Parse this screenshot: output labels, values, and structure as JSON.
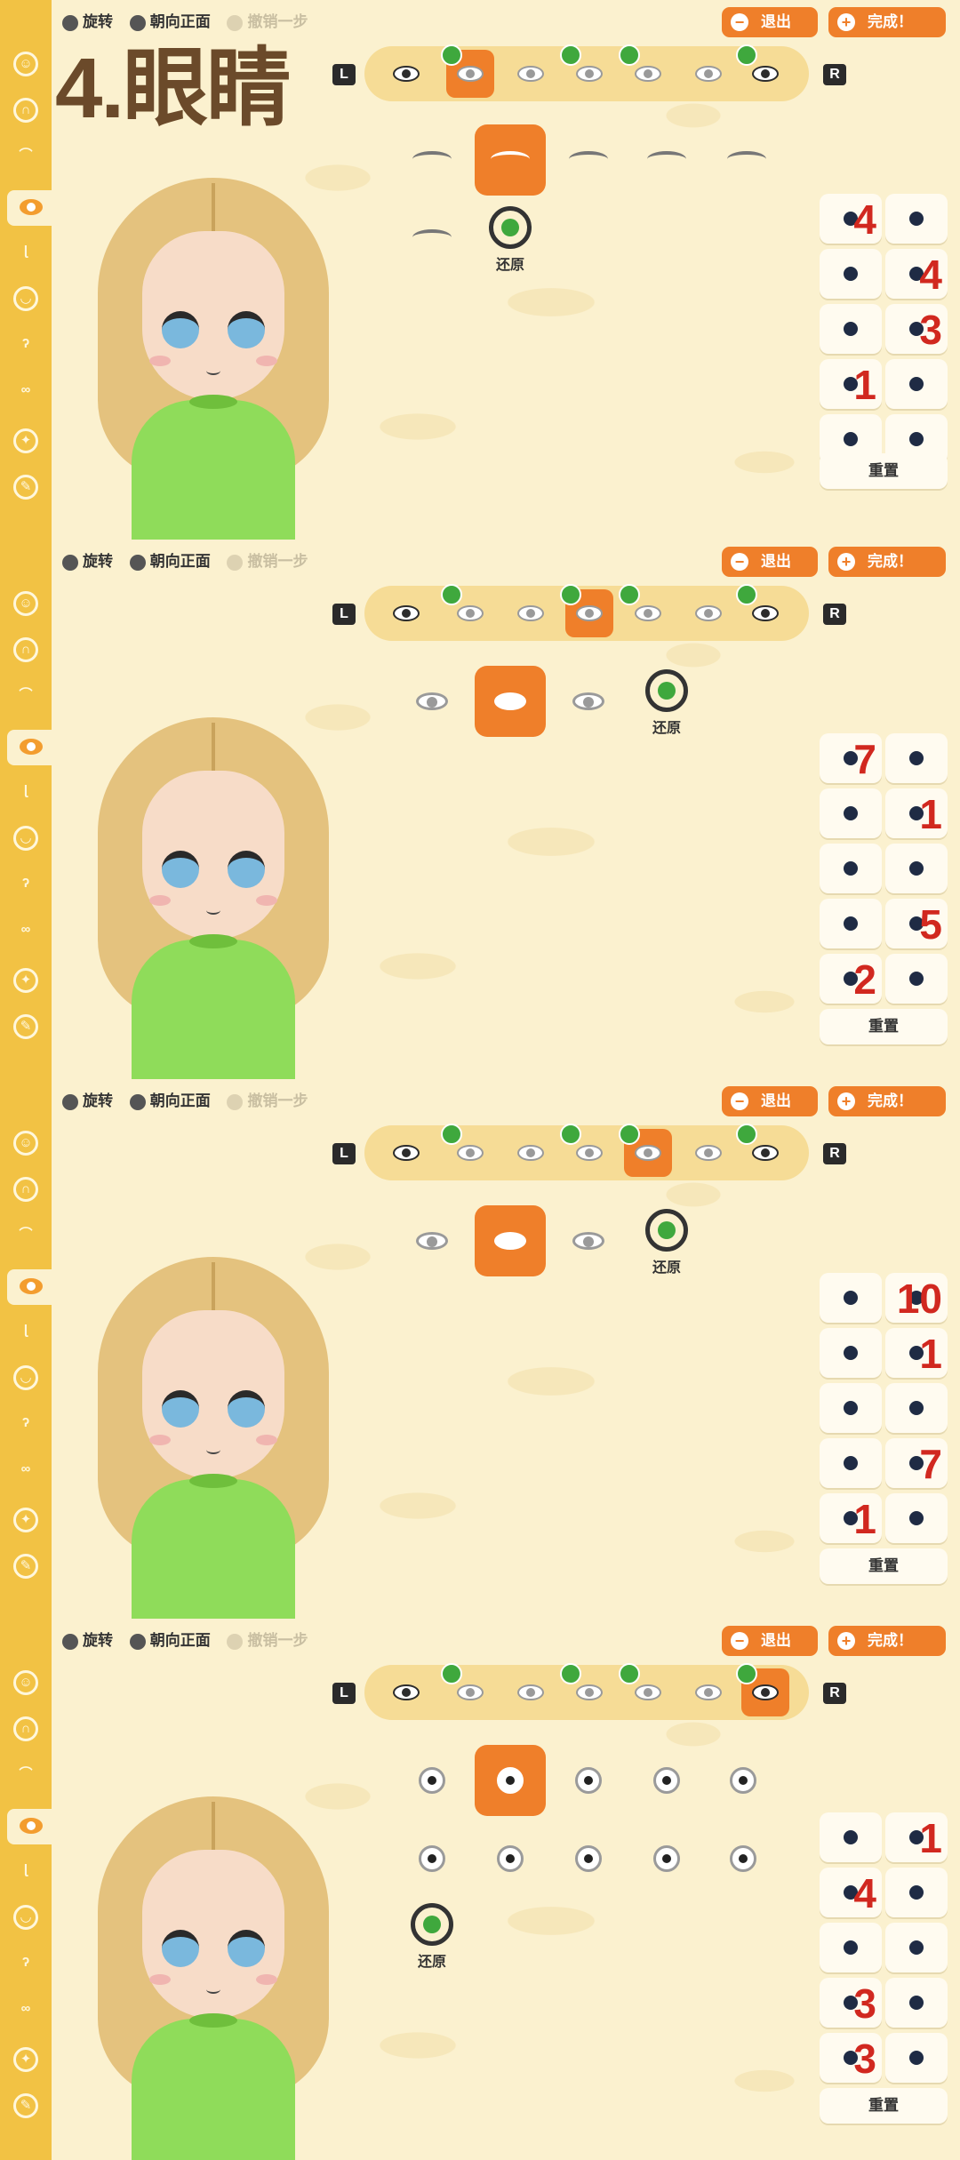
{
  "toolbar": {
    "rotate_label": "旋转",
    "face_front_label": "朝向正面",
    "undo_label": "撤销一步",
    "exit_label": "退出",
    "done_label": "完成！"
  },
  "title": "4.眼睛",
  "left_bumper": "L",
  "right_bumper": "R",
  "restore_label": "还原",
  "reset_label": "重置",
  "panels": [
    {
      "selected_tab": 1,
      "selected_option": 1,
      "adjust_numbers": [
        "4",
        "",
        "",
        "4",
        "",
        "3",
        "1",
        "",
        "",
        ""
      ]
    },
    {
      "selected_tab": 4,
      "selected_option": 1,
      "adjust_numbers": [
        "7",
        "",
        "",
        "1",
        "",
        "",
        "",
        "5",
        "2",
        ""
      ]
    },
    {
      "selected_tab": 5,
      "selected_option": 1,
      "adjust_numbers": [
        "",
        "10",
        "",
        "1",
        "",
        "",
        "",
        "7",
        "1",
        ""
      ]
    },
    {
      "selected_tab": 9,
      "selected_option": 1,
      "adjust_numbers": [
        "",
        "1",
        "4",
        "",
        "",
        "",
        "3",
        "",
        "3",
        ""
      ]
    }
  ],
  "icons": {
    "exit_icon": "minus-circle-icon",
    "done_icon": "plus-circle-icon",
    "restore_icon": "restore-icon",
    "tab_icon": "eye-icon"
  },
  "colors": {
    "accent": "#ef7f2a",
    "sidebar": "#f2c244",
    "background": "#fbf1cf",
    "number": "#d1281f"
  }
}
